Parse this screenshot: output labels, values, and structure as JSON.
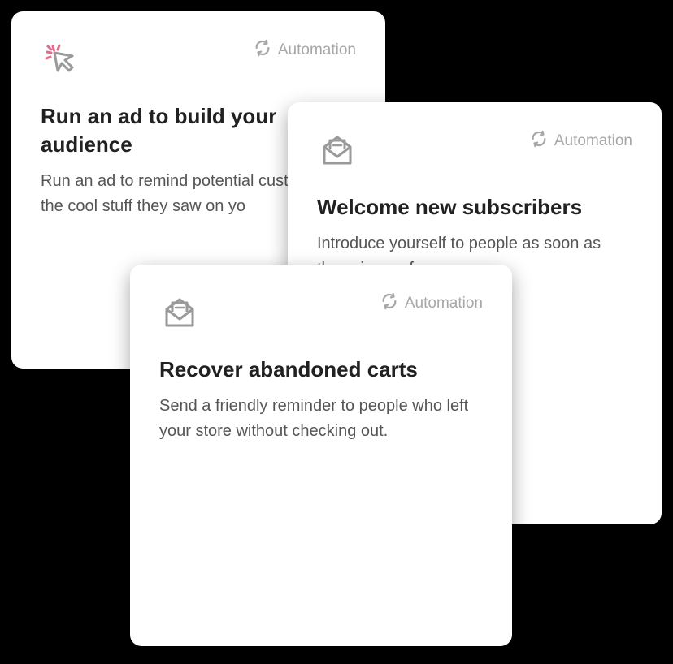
{
  "badge_label": "Automation",
  "cards": {
    "run_ad": {
      "title": "Run an ad to build your audience",
      "description": "Run an ad to remind potential customers of the cool stuff they saw on yo"
    },
    "welcome": {
      "title": "Welcome new subscribers",
      "description": "Introduce yourself to people as soon as they sign up from you."
    },
    "recover": {
      "title": "Recover abandoned carts",
      "description": "Send a friendly reminder to people who left your store without checking out."
    }
  }
}
